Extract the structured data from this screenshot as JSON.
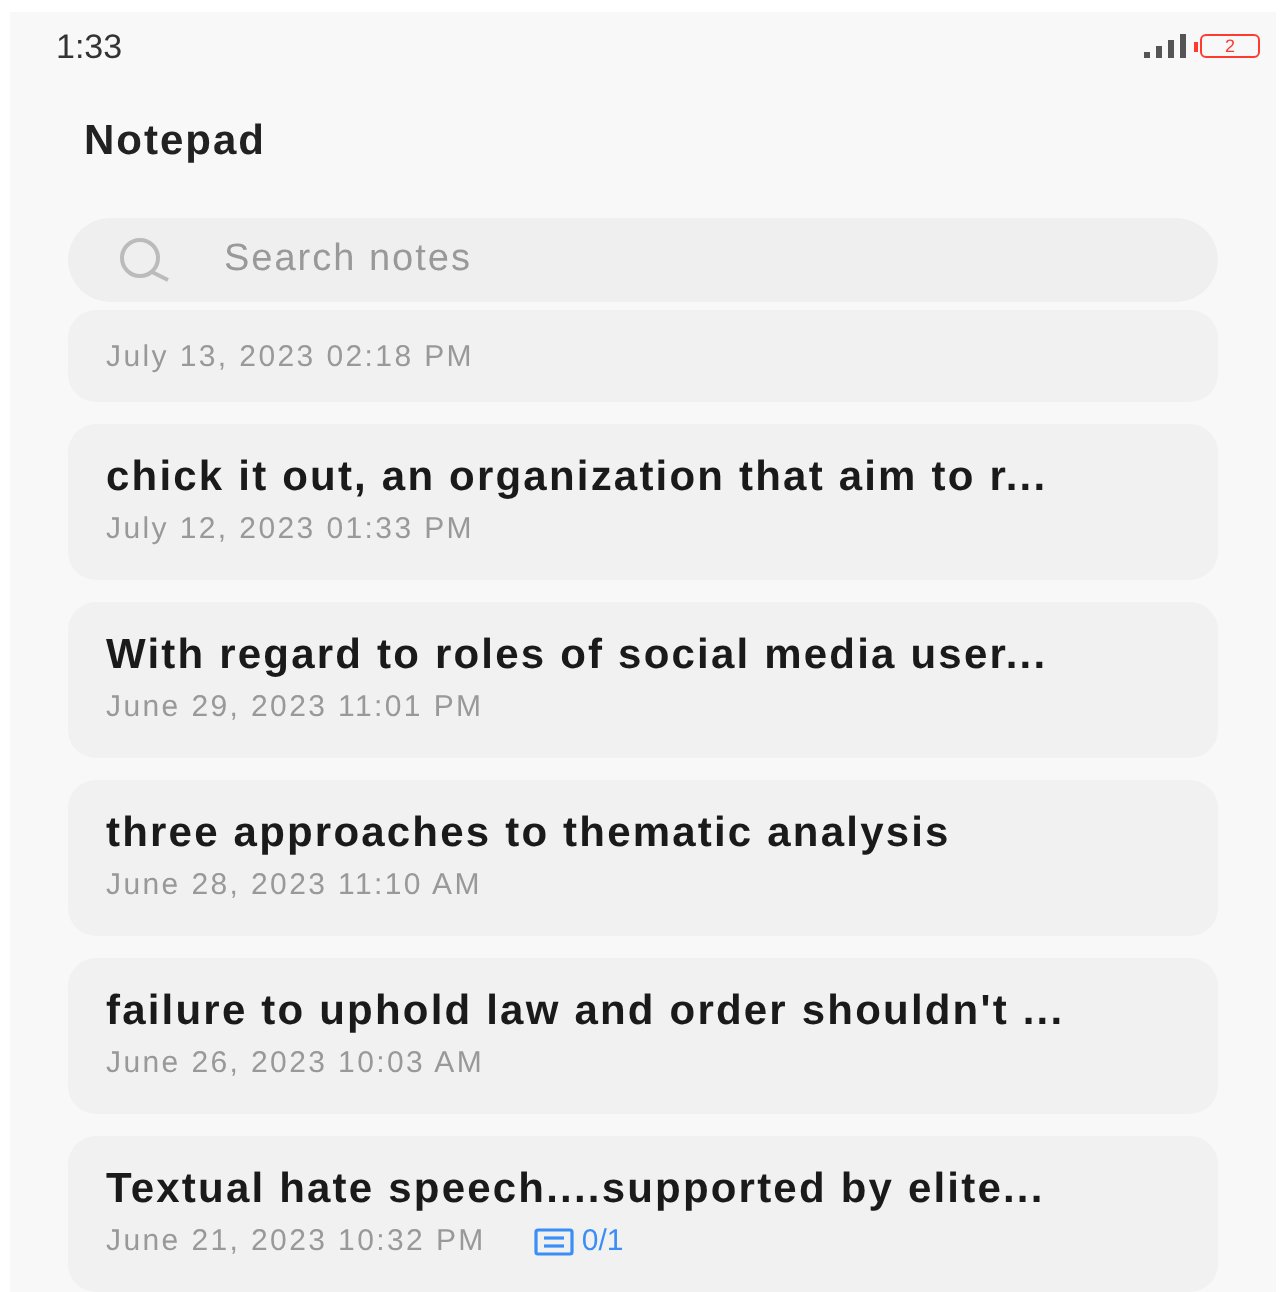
{
  "status_bar": {
    "time": "1:33",
    "battery": "2"
  },
  "title": "Notepad",
  "search": {
    "placeholder": "Search notes"
  },
  "notes": [
    {
      "date": "July 13, 2023 02:18 PM"
    },
    {
      "title": "chick it out, an organization that aim to r...",
      "date": "July 12, 2023 01:33 PM"
    },
    {
      "title": "With regard to roles of social media user...",
      "date": "June 29, 2023 11:01 PM"
    },
    {
      "title": "three approaches to thematic analysis",
      "date": "June 28, 2023 11:10 AM"
    },
    {
      "title": "failure to uphold law and order shouldn't ...",
      "date": "June 26, 2023 10:03 AM"
    },
    {
      "title": "Textual hate speech....supported by elite...",
      "date": "June 21, 2023 10:32 PM",
      "checklist": "0/1"
    }
  ]
}
